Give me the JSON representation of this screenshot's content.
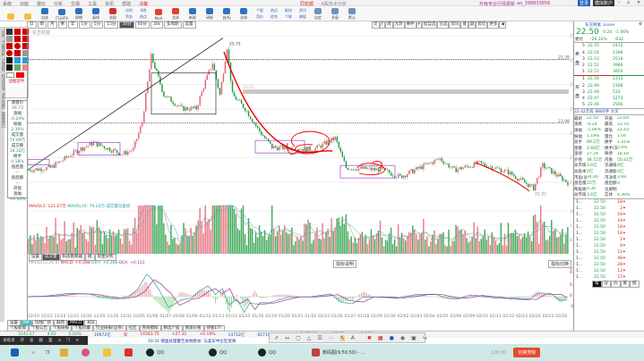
{
  "window": {
    "menu": [
      "系统",
      "功能",
      "报价",
      "分析",
      "交易",
      "工具",
      "资讯",
      "帮助"
    ],
    "menu_active": "决策",
    "brand": "同花顺",
    "app_title": "- A股技术分析",
    "user": "升级专业行情更新",
    "account": "ao_398833856",
    "buttons": [
      "登录",
      "模拟账户"
    ]
  },
  "toolbar": {
    "items": [
      "",
      "",
      "自选",
      "F10/F9",
      "周期",
      "画线",
      "选股",
      "",
      "",
      "",
      "",
      "MoA",
      "龙虎",
      "新股",
      "研报",
      "自/标",
      "全球",
      "",
      "",
      "",
      "",
      "自定",
      "多窗",
      "默认"
    ],
    "pairs": [
      [
        "分时",
        "资金"
      ],
      [
        "K线",
        "热点"
      ],
      [
        "个股",
        "竞价"
      ],
      [
        "热点",
        "综合"
      ],
      [
        "板块",
        "个股"
      ],
      [
        "资讯",
        "美股"
      ]
    ]
  },
  "period_bar": {
    "items": [
      "日",
      "周",
      "月",
      "季",
      "年",
      "1分",
      "5分",
      "15分",
      "30分",
      "60分",
      "30s",
      "多周期",
      "设置"
    ],
    "selected": "30分",
    "stock_label": "东方财富"
  },
  "right_tabs": [
    "叉",
    "F",
    "周",
    "九转",
    "事件",
    "▾",
    "加自选",
    "已选",
    "资讯",
    "盘",
    "副",
    "剪切",
    "更多",
    "◀"
  ],
  "sidebar_tabs": [
    "分时",
    "个股资料",
    "自选股",
    "综合排名",
    "主力监控",
    "超级盘口"
  ],
  "palette": {
    "label": "边框前牛"
  },
  "info_panel": [
    [
      "收盘价",
      "26.73"
    ],
    [
      "涨幅",
      "-0.24%"
    ],
    [
      "振幅",
      "2.39%"
    ],
    [
      "成交量",
      "74.09万"
    ],
    [
      "成交额",
      "18.32亿"
    ],
    [
      "换手",
      "0.58%"
    ],
    [
      "盘后量",
      "—"
    ],
    [
      "盘后额",
      "—"
    ],
    [
      "开盘",
      ""
    ],
    [
      "涨幅",
      "+0.00%"
    ]
  ],
  "price_axis": [
    "25.90",
    "25.37",
    "24.83",
    "24.29",
    "23.75",
    "23.22",
    "22.68"
  ],
  "price_labels": {
    "high": "25.71",
    "low": "22.33",
    "level_top": "25.38",
    "level_mid": "23.98",
    "gray_band": "24.65"
  },
  "price_path": [
    [
      0,
      22.95
    ],
    [
      12,
      23.0
    ],
    [
      28,
      23.4
    ],
    [
      36,
      23.55
    ],
    [
      52,
      23.3
    ],
    [
      58,
      23.4
    ],
    [
      63,
      24.0
    ],
    [
      68,
      25.45
    ],
    [
      75,
      24.6
    ],
    [
      85,
      24.3
    ],
    [
      93,
      24.3
    ],
    [
      98,
      24.9
    ],
    [
      102,
      25.3
    ],
    [
      106,
      24.6
    ],
    [
      110,
      25.65
    ],
    [
      113,
      24.6
    ],
    [
      120,
      24.3
    ],
    [
      128,
      23.8
    ],
    [
      135,
      23.45
    ],
    [
      158,
      23.4
    ],
    [
      170,
      23.65
    ],
    [
      176,
      23.0
    ],
    [
      196,
      22.95
    ],
    [
      206,
      22.8
    ],
    [
      228,
      23.2
    ],
    [
      236,
      22.95
    ],
    [
      250,
      23.1
    ],
    [
      266,
      22.9
    ],
    [
      280,
      22.55
    ],
    [
      285,
      23.05
    ],
    [
      300,
      22.65
    ]
  ],
  "volume": {
    "header": {
      "vol": "万",
      "ma5": "MAVOL5: 121.67万",
      "ma10": "MAVOL10: 79.20万",
      "extra": "成交量日复权"
    },
    "axis": [
      "2633",
      "1755",
      "878"
    ],
    "tabs": [
      "设置",
      "成交量",
      "私房看跌器",
      "融",
      "资金分析"
    ],
    "tab_selected": "成交量"
  },
  "macd": {
    "header": {
      "name": "MACD(12,26,9)",
      "macd": "MACD: +0.288",
      "diff": "DIFF: +0.288",
      "dea": "DEA: +0.122"
    },
    "axis": [
      "0.423",
      "0.352",
      "0.176",
      "0",
      "-0.176"
    ],
    "center_tabs": [
      "指标说明"
    ],
    "right_tab": "指标切换"
  },
  "dates": [
    "12/19",
    "12/23",
    "12/24",
    "12/25",
    "12/26",
    "12/29",
    "12/30",
    "12/31",
    "01/05",
    "01/06",
    "01/07",
    "01/08",
    "01/09",
    "01/12",
    "01/13",
    "01/14",
    "01/15",
    "01/16",
    "01/19",
    "01/20",
    "01/21",
    "01/22",
    "01/23",
    "01/26",
    "01/27",
    "01/28",
    "01/29",
    "01/30",
    "02/02",
    "02/03",
    "02/04",
    "02/05",
    "02/06",
    "02/09",
    "02/10",
    "02/11",
    "02/12",
    "02/13",
    "02/24",
    "02/25",
    "02/26"
  ],
  "bottom_tabs": [
    "设置",
    "MA",
    "均线广场",
    "鼓捞",
    "MACD",
    "KDJ"
  ],
  "bottom_tab_selected": "MACD",
  "function_tabs": [
    "个股新闻",
    "个股公告",
    "个股研报",
    "个股问董",
    "行业研报(证券)",
    "社区",
    "券商模拟",
    "精选个股",
    "猜涨价格",
    "停板ETF"
  ],
  "quote": {
    "name": "东方财富",
    "code": "300059",
    "price": "22.50",
    "change": "-0.24",
    "pct": "-1.06%",
    "weibi_label": "委比",
    "weibi": "-26.32%",
    "weicha": "-632",
    "asks": [
      [
        "5",
        "22.55",
        "2415"
      ],
      [
        "4",
        "22.54",
        "2396"
      ],
      [
        "3",
        "22.53",
        "2510"
      ],
      [
        "2",
        "22.52",
        "3986"
      ],
      [
        "1",
        "22.51",
        "3854"
      ]
    ],
    "bids": [
      [
        "1",
        "22.50",
        "2313"
      ],
      [
        "2",
        "22.49",
        "2168"
      ],
      [
        "3",
        "22.48",
        "533"
      ],
      [
        "4",
        "22.47",
        "1273"
      ],
      [
        "5",
        "22.46",
        "2566"
      ]
    ],
    "ask_label": "卖盘",
    "bid_label": "买盘",
    "bigorder": "22.42元有 8866手 大买",
    "stats": [
      [
        "最新",
        "22.50",
        "开盘",
        "22.69"
      ],
      [
        "涨跌",
        "-0.24",
        "最高",
        "22.70"
      ],
      [
        "涨幅",
        "-1.06%",
        "最低",
        "22.43"
      ],
      [
        "振幅",
        "1.19%",
        "量比",
        "1.04"
      ],
      [
        "总手",
        "89.2万",
        "换手",
        "1.41%"
      ],
      [
        "金额",
        "2.60亿",
        "换手(实)",
        "2.0%"
      ],
      [
        "涨停",
        "27.29",
        "跌停",
        "18.19"
      ],
      [
        "外盘",
        "38.72万",
        "内盘",
        "50.43万"
      ],
      [
        "总市值",
        "3.6亿",
        "流通值",
        "0亿"
      ],
      [
        "总股本",
        "0亿",
        "流通股",
        "0亿"
      ],
      [
        "市盈(动)",
        "34.00",
        "市净率",
        "3.69"
      ],
      [
        "盘后量",
        "25万",
        "盘后额",
        "0"
      ],
      [
        "每股收益",
        "0.30",
        "注册制上市",
        ""
      ],
      [
        "总市值",
        "3.6亿",
        "实体",
        "4.39%"
      ]
    ],
    "ticks": [
      [
        "1...",
        "22.50",
        "18"
      ],
      [
        "1...",
        "22.50",
        "2"
      ],
      [
        "1...",
        "22.50",
        "18"
      ],
      [
        "1...",
        "22.50",
        "18"
      ],
      [
        "1...",
        "22.50",
        "18"
      ],
      [
        "1...",
        "22.50",
        "18"
      ],
      [
        "1...",
        "22.50",
        "1"
      ],
      [
        "1...",
        "22.50",
        "8"
      ],
      [
        "1...",
        "22.50",
        "11"
      ],
      [
        "1...",
        "22.50",
        "48"
      ],
      [
        "1...",
        "22.50",
        "28"
      ],
      [
        "1...",
        "22.50",
        "12"
      ],
      [
        "1...",
        "22.50",
        "57"
      ]
    ],
    "tick_tabs": [
      "笔",
      "分",
      "价",
      "筹",
      "统"
    ]
  },
  "index_bar": [
    {
      "name": "",
      "value": "3141.57",
      "chg": "4.65",
      "pct": "0.03%",
      "amt": "10672亿"
    },
    {
      "name": "深",
      "value": "14583.75",
      "chg": "+27.32",
      "pct": "+0.19%",
      "amt": "14712亿"
    },
    {
      "name": "",
      "value": "",
      "chg": "",
      "pct": "",
      "amt": "6571亿"
    },
    {
      "name": "创",
      "value": "1485.86",
      "chg": "+12.58",
      "pct": "+0.85%",
      "amt": "836亿"
    }
  ],
  "news": [
    "20:31 德国总理警告协防欧洲: 与美军中企区贸易",
    "Momenta获奖升级合作谈解新北京"
  ],
  "float_bar": [
    "承接承",
    "开",
    "表",
    "删",
    "置",
    "⊙",
    "❐",
    "✕"
  ],
  "taskbar": {
    "apps": [
      "QQ",
      "QQ",
      "QQ",
      "筹码图(9.50.50) - ..."
    ],
    "timer": "120:00",
    "action": "切换宠物"
  },
  "colors": {
    "up": "#e06070",
    "down": "#1a9a3a",
    "accent": "#d02020",
    "box": "#9b45c8"
  }
}
